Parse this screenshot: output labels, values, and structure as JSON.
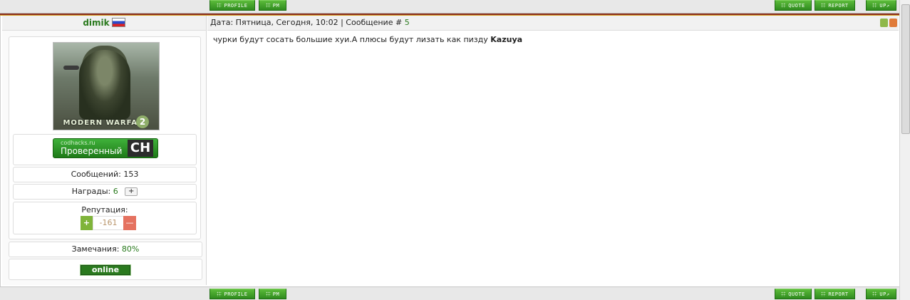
{
  "buttons": {
    "profile": "PROFILE",
    "pm": "PM",
    "quote": "QUOTE",
    "report": "REPORT",
    "up": "UP"
  },
  "post": {
    "username": "dimik",
    "date_label": "Дата: Пятница, Сегодня, 10:02 | Сообщение #",
    "post_number": "5",
    "message_text": "чурки будут сосать большие хуи.А плюсы будут лизать как пизду",
    "message_bold": "Kazuya"
  },
  "profile": {
    "avatar_caption": "MODERN WARFARE",
    "avatar_number": "2",
    "badge_site": "codhacks.ru",
    "badge_label": "Проверенный",
    "badge_logo": "CH",
    "messages_label": "Сообщений:",
    "messages_count": "153",
    "awards_label": "Награды:",
    "awards_count": "6",
    "awards_plus": "+",
    "reputation_label": "Репутация:",
    "rep_plus": "+",
    "reputation_value": "-161",
    "rep_minus": "—",
    "warnings_label": "Замечания:",
    "warnings_value": "80%",
    "status": "online"
  },
  "icons": {
    "flag": "russia-flag-icon",
    "thumbs_up": "thumbs-up-icon",
    "thumbs_down": "thumbs-down-icon",
    "dots": "dots-icon",
    "up_arrow": "up-arrow-icon"
  },
  "colors": {
    "accent_green": "#2a7a1e",
    "button_green": "#3f9e2a",
    "separator": "#8b2f1e",
    "rep_plus": "#7fb43a",
    "rep_minus": "#e57260"
  }
}
